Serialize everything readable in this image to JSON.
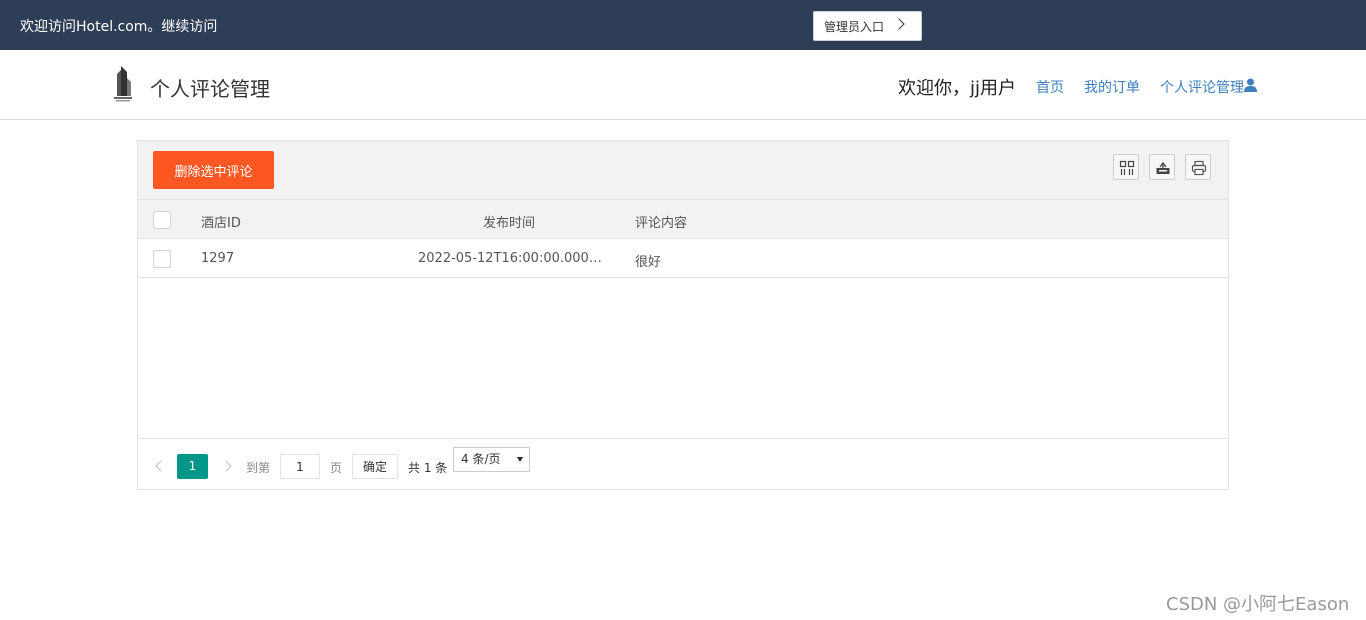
{
  "topbar": {
    "welcome": "欢迎访问Hotel.com。继续访问",
    "admin_button": "管理员入口"
  },
  "header": {
    "title": "个人评论管理",
    "greeting": "欢迎你，jj用户",
    "nav": [
      "首页",
      "我的订单",
      "个人评论管理"
    ],
    "icons": [
      "hotel-building-logo",
      "user-icon"
    ]
  },
  "toolbar": {
    "delete_label": "删除选中评论",
    "icons": [
      "columns-icon",
      "export-icon",
      "print-icon"
    ]
  },
  "table": {
    "columns": [
      "酒店ID",
      "发布时间",
      "评论内容"
    ],
    "rows": [
      {
        "hotel_id": "1297",
        "time": "2022-05-12T16:00:00.000+...",
        "content": "很好"
      }
    ]
  },
  "pagination": {
    "current": "1",
    "goto_label": "到第",
    "page_input": "1",
    "page_label": "页",
    "confirm_label": "确定",
    "total": "共 1 条",
    "page_size": "4 条/页"
  },
  "watermark": "CSDN @小阿七Eason",
  "colors": {
    "topbar": "#2f3e57",
    "danger": "#ff5722",
    "primary": "#009688",
    "link": "#3f7fbf"
  }
}
